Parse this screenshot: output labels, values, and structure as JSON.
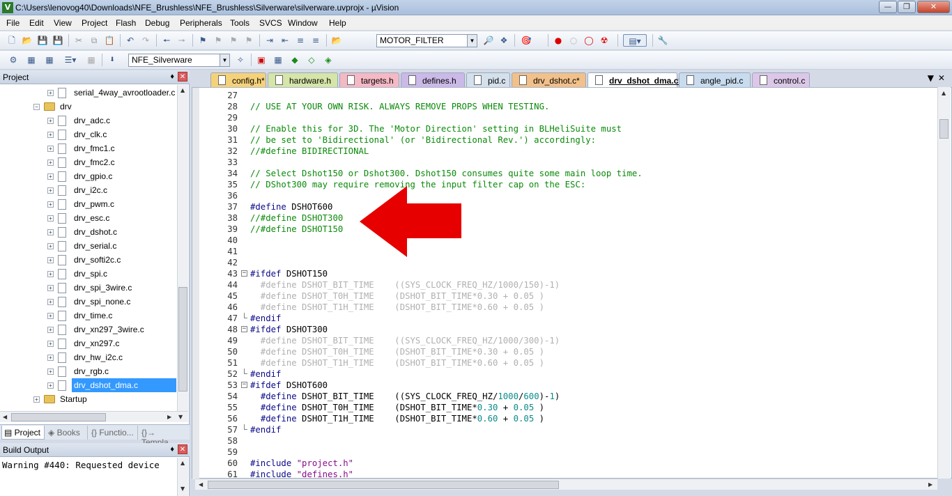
{
  "window": {
    "title": "C:\\Users\\lenovog40\\Downloads\\NFE_Brushless\\NFE_Brushless\\Silverware\\silverware.uvprojx - µVision"
  },
  "menu": [
    "File",
    "Edit",
    "View",
    "Project",
    "Flash",
    "Debug",
    "Peripherals",
    "Tools",
    "SVCS",
    "Window",
    "Help"
  ],
  "toolbar": {
    "find_combo": "MOTOR_FILTER",
    "target_combo": "NFE_Silverware"
  },
  "project_panel": {
    "title": "Project",
    "tree": [
      {
        "label": "serial_4way_avrootloader.c",
        "type": "file",
        "level": 2
      },
      {
        "label": "drv",
        "type": "folder",
        "level": 1
      },
      {
        "label": "drv_adc.c",
        "type": "file",
        "level": 2
      },
      {
        "label": "drv_clk.c",
        "type": "file",
        "level": 2
      },
      {
        "label": "drv_fmc1.c",
        "type": "file",
        "level": 2
      },
      {
        "label": "drv_fmc2.c",
        "type": "file",
        "level": 2
      },
      {
        "label": "drv_gpio.c",
        "type": "file",
        "level": 2
      },
      {
        "label": "drv_i2c.c",
        "type": "file",
        "level": 2
      },
      {
        "label": "drv_pwm.c",
        "type": "file",
        "level": 2
      },
      {
        "label": "drv_esc.c",
        "type": "file",
        "level": 2
      },
      {
        "label": "drv_dshot.c",
        "type": "file",
        "level": 2
      },
      {
        "label": "drv_serial.c",
        "type": "file",
        "level": 2
      },
      {
        "label": "drv_softi2c.c",
        "type": "file",
        "level": 2
      },
      {
        "label": "drv_spi.c",
        "type": "file",
        "level": 2
      },
      {
        "label": "drv_spi_3wire.c",
        "type": "file",
        "level": 2
      },
      {
        "label": "drv_spi_none.c",
        "type": "file",
        "level": 2
      },
      {
        "label": "drv_time.c",
        "type": "file",
        "level": 2
      },
      {
        "label": "drv_xn297_3wire.c",
        "type": "file",
        "level": 2
      },
      {
        "label": "drv_xn297.c",
        "type": "file",
        "level": 2
      },
      {
        "label": "drv_hw_i2c.c",
        "type": "file",
        "level": 2
      },
      {
        "label": "drv_rgb.c",
        "type": "file",
        "level": 2
      },
      {
        "label": "drv_dshot_dma.c",
        "type": "file",
        "level": 2,
        "selected": true
      },
      {
        "label": "Startup",
        "type": "folder",
        "level": 1
      }
    ],
    "tabs": [
      "Project",
      "Books",
      "{} Functio...",
      "{}→ Templa..."
    ]
  },
  "build_panel": {
    "title": "Build Output",
    "text": "Warning #440: Requested device"
  },
  "editor_tabs": [
    {
      "label": "config.h*",
      "color": "#f5d27a"
    },
    {
      "label": "hardware.h",
      "color": "#d6e5a8"
    },
    {
      "label": "targets.h",
      "color": "#f4b9c5"
    },
    {
      "label": "defines.h",
      "color": "#cbb9e8"
    },
    {
      "label": "pid.c",
      "color": "#d4e0ec"
    },
    {
      "label": "drv_dshot.c*",
      "color": "#f2c08a"
    },
    {
      "label": "drv_dshot_dma.c*",
      "color": "#ffffff",
      "active": true
    },
    {
      "label": "angle_pid.c",
      "color": "#c9dcef"
    },
    {
      "label": "control.c",
      "color": "#dcc7e8"
    }
  ],
  "code": [
    {
      "n": "27",
      "t": ""
    },
    {
      "n": "28",
      "t": "// USE AT YOUR OWN RISK. ALWAYS REMOVE PROPS WHEN TESTING.",
      "c": "cm"
    },
    {
      "n": "29",
      "t": ""
    },
    {
      "n": "30",
      "t": "// Enable this for 3D. The 'Motor Direction' setting in BLHeliSuite must",
      "c": "cm"
    },
    {
      "n": "31",
      "t": "// be set to 'Bidirectional' (or 'Bidirectional Rev.') accordingly:",
      "c": "cm"
    },
    {
      "n": "32",
      "t": "//#define BIDIRECTIONAL",
      "c": "cm"
    },
    {
      "n": "33",
      "t": ""
    },
    {
      "n": "34",
      "t": "// Select Dshot150 or Dshot300. Dshot150 consumes quite some main loop time.",
      "c": "cm"
    },
    {
      "n": "35",
      "t": "// DShot300 may require removing the input filter cap on the ESC:",
      "c": "cm"
    },
    {
      "n": "36",
      "t": ""
    },
    {
      "n": "37",
      "t": "#define DSHOT600",
      "c": "ppkw"
    },
    {
      "n": "38",
      "t": "//#define DSHOT300",
      "c": "cm"
    },
    {
      "n": "39",
      "t": "//#define DSHOT150",
      "c": "cm"
    },
    {
      "n": "40",
      "t": ""
    },
    {
      "n": "41",
      "t": ""
    },
    {
      "n": "42",
      "t": ""
    },
    {
      "n": "43",
      "t": "#ifdef DSHOT150",
      "c": "ppkw",
      "fold": "-"
    },
    {
      "n": "44",
      "t": "  #define DSHOT_BIT_TIME    ((SYS_CLOCK_FREQ_HZ/1000/150)-1)",
      "c": "dim"
    },
    {
      "n": "45",
      "t": "  #define DSHOT_T0H_TIME    (DSHOT_BIT_TIME*0.30 + 0.05 )",
      "c": "dim"
    },
    {
      "n": "46",
      "t": "  #define DSHOT_T1H_TIME    (DSHOT_BIT_TIME*0.60 + 0.05 )",
      "c": "dim"
    },
    {
      "n": "47",
      "t": "#endif",
      "c": "pp",
      "fold": "end"
    },
    {
      "n": "48",
      "t": "#ifdef DSHOT300",
      "c": "ppkw",
      "fold": "-"
    },
    {
      "n": "49",
      "t": "  #define DSHOT_BIT_TIME    ((SYS_CLOCK_FREQ_HZ/1000/300)-1)",
      "c": "dim"
    },
    {
      "n": "50",
      "t": "  #define DSHOT_T0H_TIME    (DSHOT_BIT_TIME*0.30 + 0.05 )",
      "c": "dim"
    },
    {
      "n": "51",
      "t": "  #define DSHOT_T1H_TIME    (DSHOT_BIT_TIME*0.60 + 0.05 )",
      "c": "dim"
    },
    {
      "n": "52",
      "t": "#endif",
      "c": "pp",
      "fold": "end"
    },
    {
      "n": "53",
      "t": "#ifdef DSHOT600",
      "c": "ppkw",
      "fold": "-"
    },
    {
      "n": "54",
      "t": "  #define DSHOT_BIT_TIME    ((SYS_CLOCK_FREQ_HZ/1000/600)-1)",
      "c": "live"
    },
    {
      "n": "55",
      "t": "  #define DSHOT_T0H_TIME    (DSHOT_BIT_TIME*0.30 + 0.05 )",
      "c": "live"
    },
    {
      "n": "56",
      "t": "  #define DSHOT_T1H_TIME    (DSHOT_BIT_TIME*0.60 + 0.05 )",
      "c": "live"
    },
    {
      "n": "57",
      "t": "#endif",
      "c": "pp",
      "fold": "end"
    },
    {
      "n": "58",
      "t": ""
    },
    {
      "n": "59",
      "t": ""
    },
    {
      "n": "60",
      "t": "#include \"project.h\"",
      "c": "inc"
    },
    {
      "n": "61",
      "t": "#include \"defines.h\"",
      "c": "inc"
    }
  ],
  "colors": {
    "comment": "#0a8a0a",
    "preprocessor": "#0a0a8a",
    "number": "#0a8a8a",
    "string": "#8a0a8a",
    "arrow": "#e60000",
    "selection": "#3399ff"
  }
}
